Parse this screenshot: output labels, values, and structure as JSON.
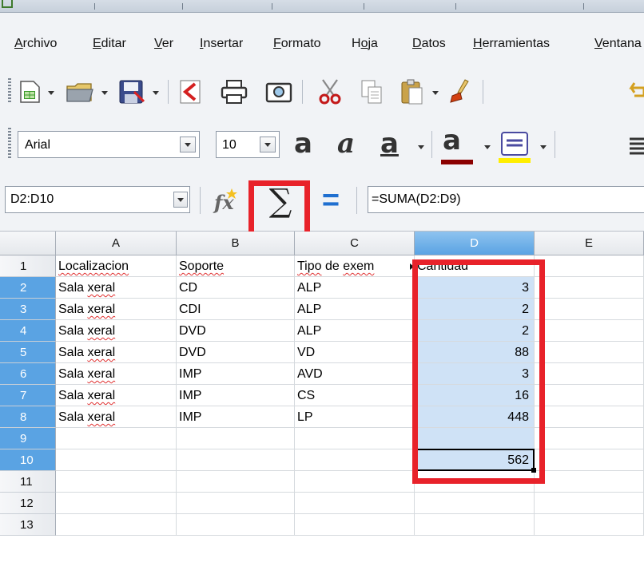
{
  "menu": [
    "Archivo",
    "Editar",
    "Ver",
    "Insertar",
    "Formato",
    "Hoja",
    "Datos",
    "Herramientas",
    "Ventana"
  ],
  "font": {
    "name": "Arial",
    "size": "10"
  },
  "formula_bar": {
    "cell_reference": "D2:D10",
    "formula": "=SUMA(D2:D9)",
    "sum_symbol": "∑",
    "equals_symbol": "="
  },
  "toolbar2_letters": {
    "bold": "a",
    "italic": "a",
    "underline": "a",
    "font_color": "a"
  },
  "colors": {
    "highlight": "#e8222a",
    "selection": "#cfe2f6",
    "header_selected": "#5aa3e3",
    "font_color_bar": "#8b0000",
    "highlight_bar": "#ffee00"
  },
  "sheet": {
    "columns": [
      "A",
      "B",
      "C",
      "D",
      "E"
    ],
    "rows": [
      "1",
      "2",
      "3",
      "4",
      "5",
      "6",
      "7",
      "8",
      "9",
      "10",
      "11",
      "12",
      "13"
    ],
    "header": [
      "Localizacion",
      "Soporte",
      "Tipo de exem",
      "Cantidad"
    ],
    "data": [
      [
        "Sala xeral",
        "CD",
        "ALP",
        "3"
      ],
      [
        "Sala xeral",
        "CDI",
        "ALP",
        "2"
      ],
      [
        "Sala xeral",
        "DVD",
        "ALP",
        "2"
      ],
      [
        "Sala xeral",
        "DVD",
        "VD",
        "88"
      ],
      [
        "Sala xeral",
        "IMP",
        "AVD",
        "3"
      ],
      [
        "Sala xeral",
        "IMP",
        "CS",
        "16"
      ],
      [
        "Sala xeral",
        "IMP",
        "LP",
        "448"
      ]
    ],
    "total": "562"
  }
}
